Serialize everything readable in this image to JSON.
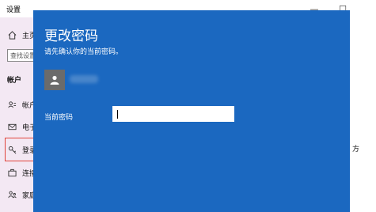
{
  "window": {
    "title": "设置",
    "controls": {
      "minimize": "—",
      "maximize": "☐",
      "close": "✕"
    }
  },
  "sidebar": {
    "home": {
      "icon": "home-icon",
      "label": "主页"
    },
    "search_placeholder": "查找设置",
    "section_title": "帐户",
    "items": [
      {
        "icon": "person-card-icon",
        "label": "帐户"
      },
      {
        "icon": "mail-icon",
        "label": "电子"
      },
      {
        "icon": "key-icon",
        "label": "登录"
      },
      {
        "icon": "briefcase-icon",
        "label": "连接"
      },
      {
        "icon": "family-icon",
        "label": "家庭"
      }
    ],
    "highlight_color": "#e0433b"
  },
  "right_panel": {
    "text": "方"
  },
  "dialog": {
    "title": "更改密码",
    "subtitle": "请先确认你的当前密码。",
    "user_name": "",
    "field_label": "当前密码",
    "field_value": "",
    "background": "#1b68c0"
  }
}
